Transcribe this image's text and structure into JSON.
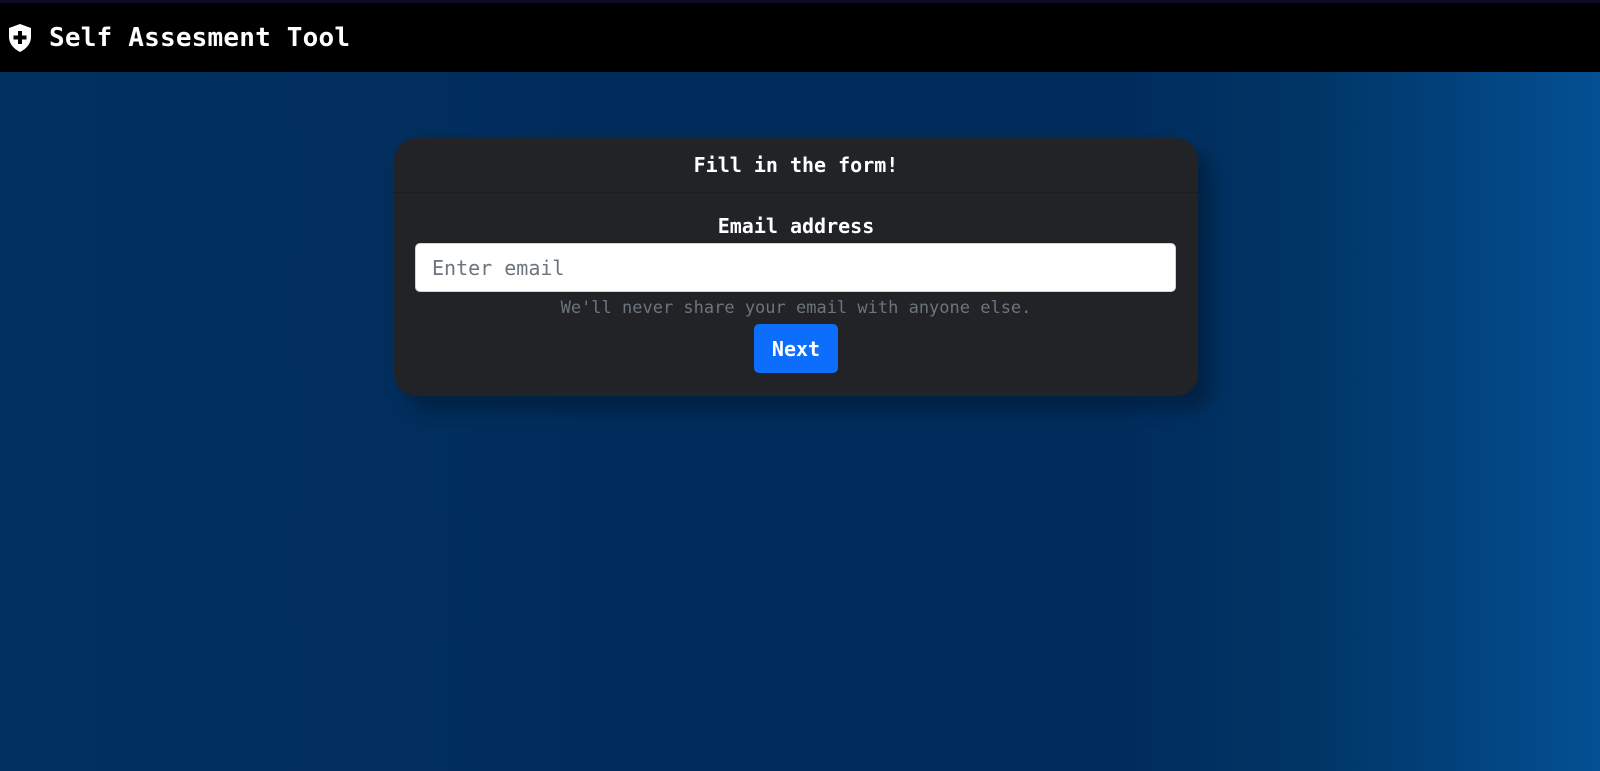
{
  "navbar": {
    "brand_icon": "shield-plus-icon",
    "title": "Self Assesment Tool"
  },
  "form": {
    "header": "Fill in the form!",
    "email_label": "Email address",
    "email_value": "",
    "email_placeholder": "Enter email",
    "help_text": "We'll never share your email with anyone else.",
    "next_label": "Next"
  },
  "colors": {
    "navbar_bg": "#000000",
    "page_bg": "#002c5c",
    "card_bg": "#212327",
    "primary_button": "#0d6efd",
    "muted_text": "#6c757d"
  }
}
